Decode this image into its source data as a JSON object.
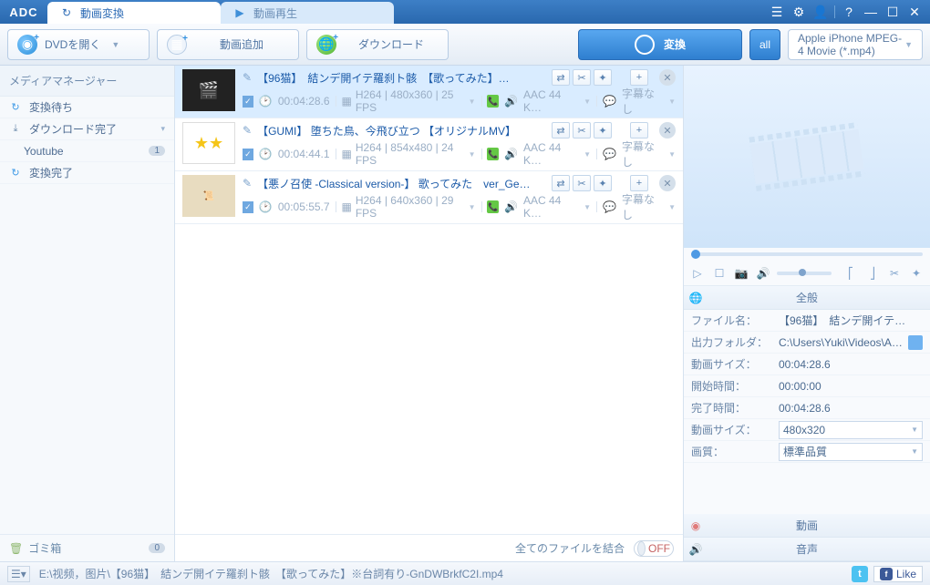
{
  "app": {
    "logo": "ADC"
  },
  "tabs": [
    {
      "label": "動画変換",
      "active": true
    },
    {
      "label": "動画再生",
      "active": false
    }
  ],
  "toolbar": {
    "dvd": "DVDを開く",
    "add": "動画追加",
    "download": "ダウンロード",
    "convert": "変換",
    "profile": "Apple iPhone MPEG-4 Movie (*.mp4)"
  },
  "sidebar": {
    "title": "メディアマネージャー",
    "items": [
      {
        "icon": "↻",
        "label": "変換待ち",
        "kind": "wait"
      },
      {
        "icon": "⤓",
        "label": "ダウンロード完了",
        "kind": "dlc",
        "expand": "▾"
      },
      {
        "icon": "",
        "label": "Youtube",
        "kind": "sub",
        "badge": "1"
      },
      {
        "icon": "↻",
        "label": "変換完了",
        "kind": "done"
      }
    ],
    "trash": {
      "label": "ゴミ箱",
      "badge": "0"
    }
  },
  "files": [
    {
      "title": "【96猫】　結ンデ開イテ羅刹ト骸　【歌ってみた】…",
      "selected": true,
      "duration": "00:04:28.6",
      "video": "H264 | 480x360 | 25 FPS",
      "audio": "AAC 44 K…",
      "subtitle": "字幕なし",
      "thumb": "dark"
    },
    {
      "title": "【GUMI】 堕ちた鳥、今飛び立つ 【オリジナルMV】",
      "selected": false,
      "duration": "00:04:44.1",
      "video": "H264 | 854x480 | 24 FPS",
      "audio": "AAC 44 K…",
      "subtitle": "字幕なし",
      "thumb": "star"
    },
    {
      "title": "【悪ノ召使 -Classical version-】 歌ってみた　ver_Ge…",
      "selected": false,
      "duration": "00:05:55.7",
      "video": "H264 | 640x360 | 29 FPS",
      "audio": "AAC 44 K…",
      "subtitle": "字幕なし",
      "thumb": "paper"
    }
  ],
  "combine": {
    "label": "全てのファイルを結合",
    "state": "OFF"
  },
  "info": {
    "general_label": "全般",
    "video_label": "動画",
    "audio_label": "音声",
    "rows": {
      "filename_k": "ファイル名：",
      "filename_v": "【96猫】　結ンデ開イテ…",
      "outfolder_k": "出力フォルダ：",
      "outfolder_v": "C:\\Users\\Yuki\\Videos\\A…",
      "size_k": "動画サイズ：",
      "size_v": "00:04:28.6",
      "start_k": "開始時間：",
      "start_v": "00:00:00",
      "end_k": "完了時間：",
      "end_v": "00:04:28.6",
      "dim_k": "動画サイズ：",
      "dim_v": "480x320",
      "quality_k": "画質：",
      "quality_v": "標準品質"
    }
  },
  "status": {
    "path": "E:\\视频，图片\\【96猫】　結ンデ開イテ羅刹ト骸　【歌ってみた】※台詞有り-GnDWBrkfC2I.mp4",
    "like": "Like"
  }
}
